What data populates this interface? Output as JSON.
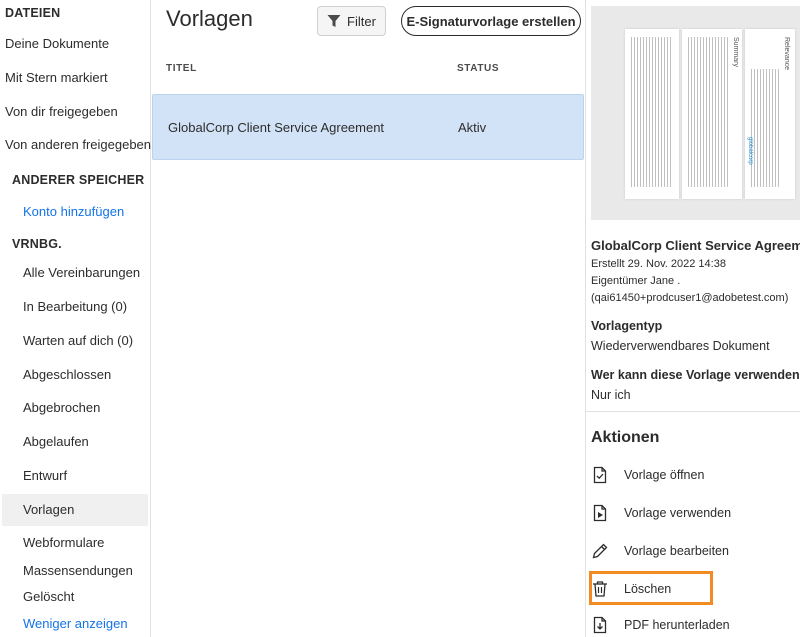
{
  "sidebar": {
    "files_header": "DATEIEN",
    "file_items": [
      "Deine Dokumente",
      "Mit Stern markiert",
      "Von dir freigegeben",
      "Von anderen freigegeben"
    ],
    "other_storage_header": "ANDERER SPEICHER",
    "add_account": "Konto hinzufügen",
    "agreements_header": "VRNBG.",
    "agreement_items": [
      "Alle Vereinbarungen",
      "In Bearbeitung (0)",
      "Warten auf dich (0)",
      "Abgeschlossen",
      "Abgebrochen",
      "Abgelaufen",
      "Entwurf",
      "Vorlagen",
      "Webformulare",
      "Massensendungen",
      "Gelöscht"
    ],
    "selected_item": "Vorlagen",
    "show_less": "Weniger anzeigen"
  },
  "main": {
    "title": "Vorlagen",
    "filter_label": "Filter",
    "create_button": "E-Signaturvorlage erstellen",
    "columns": {
      "title": "TITEL",
      "status": "STATUS"
    },
    "rows": [
      {
        "title": "GlobalCorp Client Service Agreement",
        "status": "Aktiv"
      }
    ]
  },
  "details": {
    "preview_labels": [
      "Summary",
      "Relevance"
    ],
    "preview_logo": "globalcorp",
    "doc_name": "GlobalCorp Client Service Agreement",
    "created": "Erstellt 29. Nov. 2022 14:38",
    "owner": "Eigentümer Jane .",
    "owner_email": "(qai61450+prodcuser1@adobetest.com)",
    "template_type_label": "Vorlagentyp",
    "template_type_value": "Wiederverwendbares Dokument",
    "who_can_use_label": "Wer kann diese Vorlage verwenden?",
    "who_can_use_value": "Nur ich",
    "actions_title": "Aktionen",
    "actions": [
      {
        "label": "Vorlage öffnen",
        "icon": "document-check-icon"
      },
      {
        "label": "Vorlage verwenden",
        "icon": "document-send-icon"
      },
      {
        "label": "Vorlage bearbeiten",
        "icon": "pencil-icon"
      },
      {
        "label": "Löschen",
        "icon": "trash-icon"
      },
      {
        "label": "PDF herunterladen",
        "icon": "pdf-download-icon"
      }
    ],
    "highlighted_action": "Löschen"
  },
  "colors": {
    "accent_link": "#1473e6",
    "selected_row": "#d3e3f7",
    "highlight_box": "#f38a22"
  }
}
